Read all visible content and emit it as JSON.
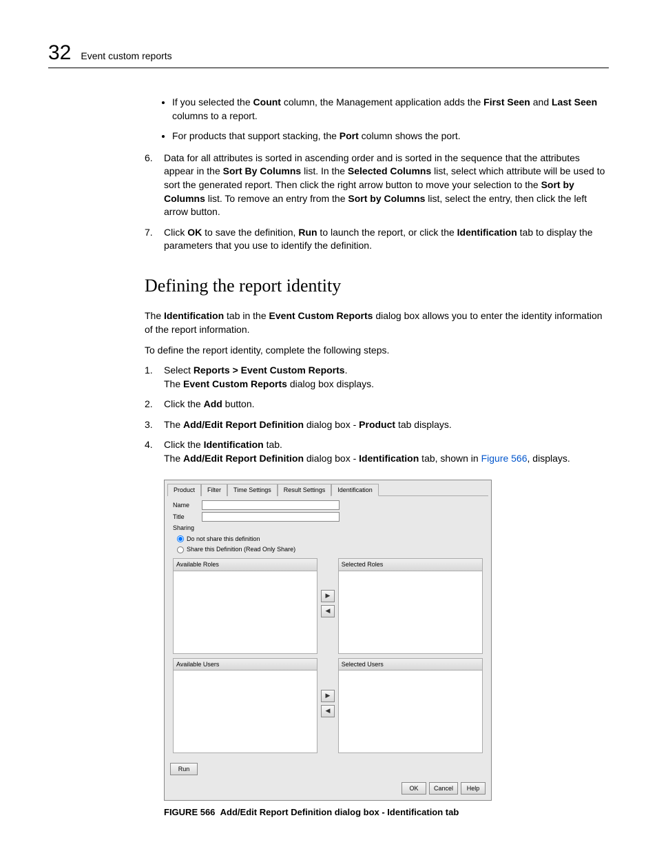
{
  "header": {
    "page_number": "32",
    "title": "Event custom reports"
  },
  "bullets_top": [
    {
      "pre": "If you selected the ",
      "b1": "Count",
      "mid1": " column, the Management application adds the ",
      "b2": "First Seen",
      "mid2": " and ",
      "b3": "Last Seen",
      "post": " columns to a report."
    },
    {
      "pre": "For products that support stacking, the ",
      "b1": "Port",
      "post": " column shows the port."
    }
  ],
  "step6": {
    "num": "6",
    "t1": "Data for all attributes is sorted in ascending order and is sorted in the sequence that the attributes appear in the ",
    "b1": "Sort By Columns",
    "t2": " list. In the ",
    "b2": "Selected Columns",
    "t3": " list, select which attribute will be used to sort the generated report. Then click the right arrow button to move your selection to the ",
    "b3": "Sort by Columns",
    "t4": " list. To remove an entry from the ",
    "b4": "Sort by Columns",
    "t5": " list, select the entry, then click the left arrow button."
  },
  "step7": {
    "num": "7",
    "t1": "Click ",
    "b1": "OK",
    "t2": " to save the definition, ",
    "b2": "Run",
    "t3": " to launch the report, or click the ",
    "b3": "Identification",
    "t4": " tab to display the parameters that you use to identify the definition."
  },
  "section_heading": "Defining the report identity",
  "intro": {
    "t1": "The ",
    "b1": "Identification",
    "t2": " tab in the ",
    "b2": "Event Custom Reports",
    "t3": " dialog box allows you to enter the identity information of the report information."
  },
  "intro2": "To define the report identity, complete the following steps.",
  "steps": {
    "s1": {
      "num": "1",
      "t1": "Select ",
      "b1": "Reports > Event Custom Reports",
      "t2": ".",
      "sub_t1": "The ",
      "sub_b1": "Event Custom Reports",
      "sub_t2": " dialog box displays."
    },
    "s2": {
      "num": "2",
      "t1": "Click the ",
      "b1": "Add",
      "t2": " button."
    },
    "s3": {
      "num": "3",
      "t1": "The ",
      "b1": "Add/Edit Report Definition",
      "t2": " dialog box - ",
      "b2": "Product",
      "t3": " tab displays."
    },
    "s4": {
      "num": "4",
      "t1": "Click the ",
      "b1": "Identification",
      "t2": " tab.",
      "sub_t1": "The ",
      "sub_b1": "Add/Edit Report Definition",
      "sub_t2": " dialog box - ",
      "sub_b2": "Identification",
      "sub_t3": " tab, shown in ",
      "sub_link": "Figure 566",
      "sub_t4": ", displays."
    }
  },
  "dialog": {
    "tabs": [
      "Product",
      "Filter",
      "Time Settings",
      "Result Settings",
      "Identification"
    ],
    "active_tab": "Identification",
    "labels": {
      "name": "Name",
      "title": "Title",
      "sharing": "Sharing"
    },
    "radio1": "Do not share this definition",
    "radio2": "Share this Definition (Read Only Share)",
    "panel_headers": {
      "avail_roles": "Available Roles",
      "sel_roles": "Selected Roles",
      "avail_users": "Available Users",
      "sel_users": "Selected Users"
    },
    "arrows": {
      "right": "▶",
      "left": "◀"
    },
    "run": "Run",
    "footer": {
      "ok": "OK",
      "cancel": "Cancel",
      "help": "Help"
    }
  },
  "figure": {
    "label": "FIGURE 566",
    "caption": "Add/Edit Report Definition dialog box - Identification tab"
  }
}
